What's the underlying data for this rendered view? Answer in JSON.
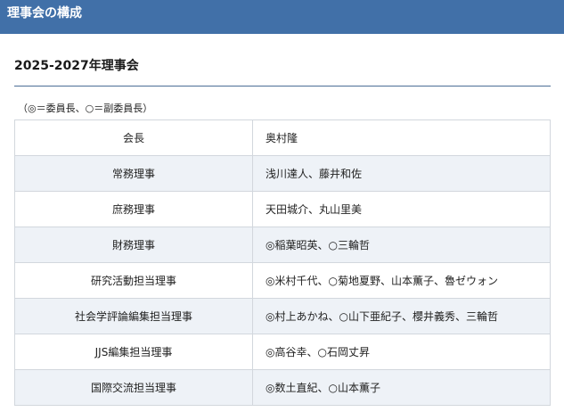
{
  "header": {
    "title": "理事会の構成"
  },
  "section": {
    "title": "2025-2027年理事会",
    "legend": "（◎＝委員長、○＝副委員長）"
  },
  "board": {
    "rows": [
      {
        "role": "会長",
        "members": "奥村隆"
      },
      {
        "role": "常務理事",
        "members": "浅川達人、藤井和佐"
      },
      {
        "role": "庶務理事",
        "members": "天田城介、丸山里美"
      },
      {
        "role": "財務理事",
        "members": "◎稲葉昭英、○三輪哲"
      },
      {
        "role": "研究活動担当理事",
        "members": "◎米村千代、○菊地夏野、山本薫子、魯ゼウォン"
      },
      {
        "role": "社会学評論編集担当理事",
        "members": "◎村上あかね、○山下亜紀子、櫻井義秀、三輪哲"
      },
      {
        "role": "JJS編集担当理事",
        "members": "◎高谷幸、○石岡丈昇"
      },
      {
        "role": "国際交流担当理事",
        "members": "◎数土直紀、○山本薫子"
      }
    ]
  }
}
